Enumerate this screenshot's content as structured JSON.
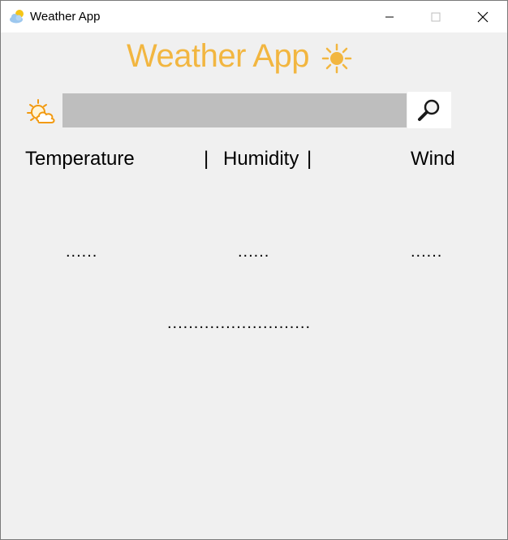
{
  "window": {
    "title": "Weather App",
    "min_label": "–",
    "max_label": "□",
    "close_label": "✕"
  },
  "app": {
    "heading": "Weather App",
    "search": {
      "value": "",
      "placeholder": ""
    },
    "labels": {
      "temperature": "Temperature",
      "sep1": "|",
      "humidity": "Humidity",
      "sep2": "|",
      "wind": "Wind"
    },
    "values": {
      "temperature": "......",
      "humidity": "......",
      "wind": "......",
      "description": "..........................."
    }
  },
  "colors": {
    "accent": "#f2b640",
    "input_bg": "#bebebe",
    "window_bg": "#f0f0f0"
  },
  "icons": [
    "weather-app-icon",
    "sun-icon",
    "partly-cloudy-icon",
    "search-icon",
    "minimize-icon",
    "maximize-icon",
    "close-icon"
  ]
}
